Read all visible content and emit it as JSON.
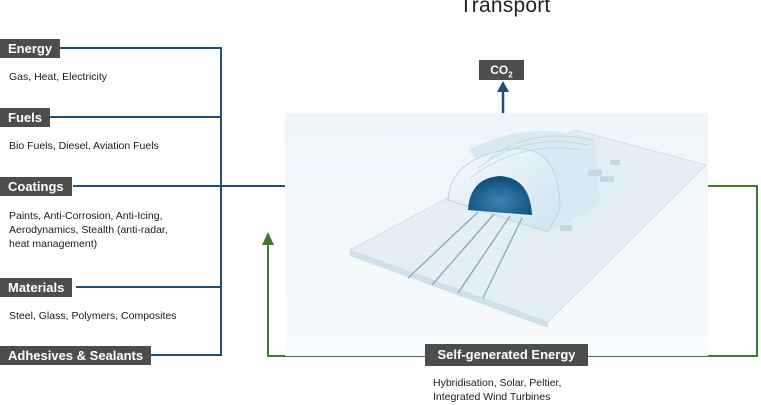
{
  "title": "Transport",
  "inputs": [
    {
      "label": "Energy",
      "desc": [
        "Gas, Heat, Electricity"
      ]
    },
    {
      "label": "Fuels",
      "desc": [
        "Bio Fuels, Diesel, Aviation Fuels"
      ]
    },
    {
      "label": "Coatings",
      "desc": [
        "Paints, Anti-Corrosion, Anti-Icing,",
        "Aerodynamics, Stealth (anti-radar,",
        "heat management)"
      ]
    },
    {
      "label": "Materials",
      "desc": [
        "Steel, Glass, Polymers, Composites"
      ]
    },
    {
      "label": "Adhesives & Sealants",
      "desc": []
    }
  ],
  "output": {
    "label_main": "CO",
    "label_sub": "2"
  },
  "feedback": {
    "label": "Self-generated Energy",
    "desc": [
      "Hybridisation, Solar, Peltier,",
      "Integrated Wind Turbines"
    ]
  },
  "colors": {
    "input_line": "#1f4e79",
    "feedback_line": "#3d7a2e",
    "box": "#4d4d4d"
  }
}
